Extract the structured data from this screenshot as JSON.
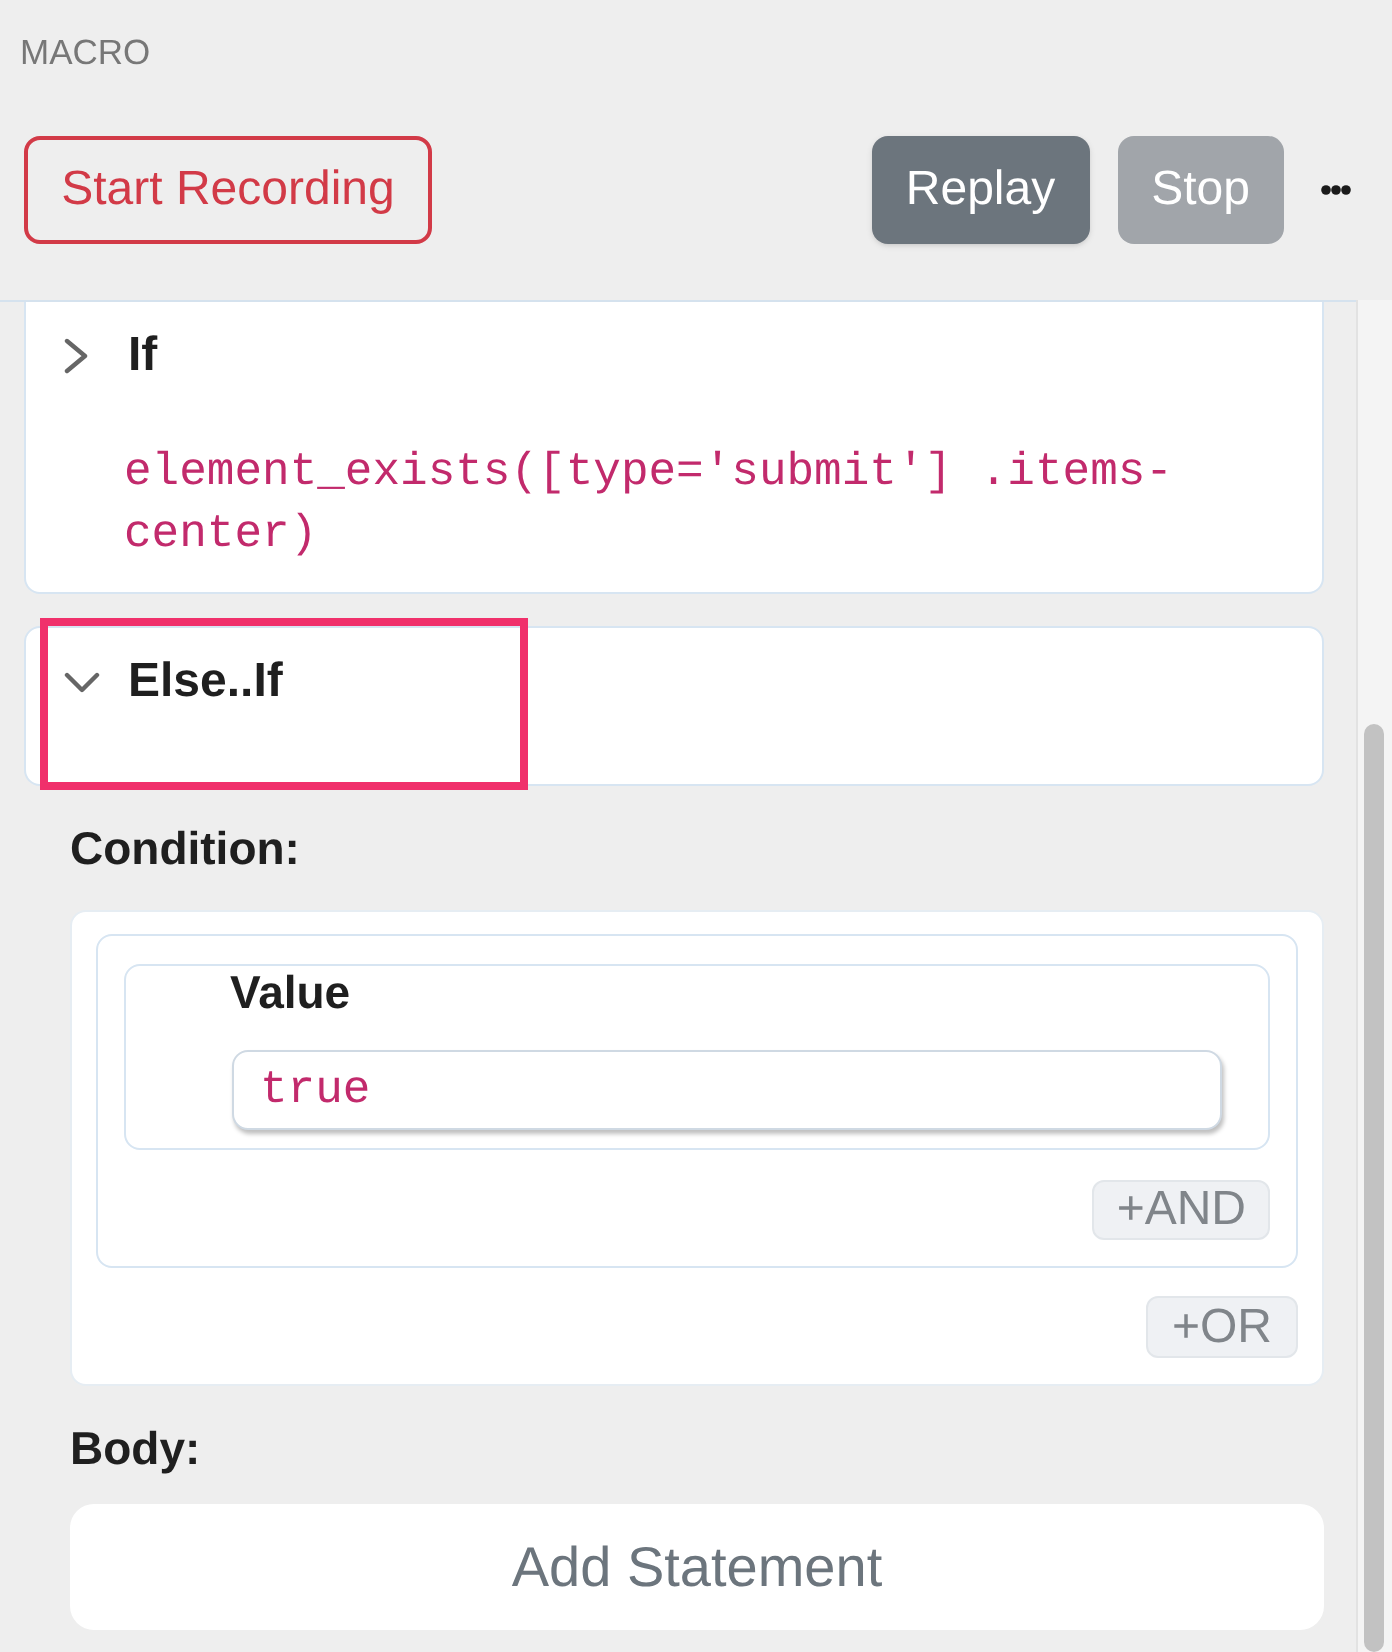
{
  "panel": {
    "title": "MACRO"
  },
  "toolbar": {
    "buttons": [
      {
        "label": "Start Recording",
        "kind": "outline",
        "disabled": false
      },
      {
        "label": "Replay",
        "kind": "solid",
        "disabled": false
      },
      {
        "label": "Stop",
        "kind": "solid",
        "disabled": true
      }
    ]
  },
  "blocks": [
    {
      "title": "If",
      "expanded": false,
      "highlighted": false,
      "expression": "element_exists([type='submit'] .items-center)"
    },
    {
      "title": "Else..If",
      "expanded": true,
      "highlighted": true,
      "condition": {
        "label": "Condition:",
        "groups": [
          {
            "rows": [
              {
                "label": "Value",
                "value": "true"
              }
            ],
            "and_button": "+AND"
          }
        ],
        "or_button": "+OR"
      },
      "body": {
        "label": "Body:",
        "add_button": "Add Statement"
      }
    }
  ]
}
